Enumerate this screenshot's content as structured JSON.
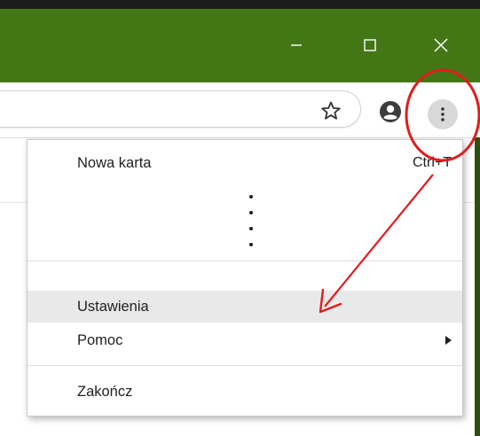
{
  "window_controls": {
    "minimize_icon": "minimize-icon",
    "maximize_icon": "maximize-icon",
    "close_icon": "close-icon"
  },
  "toolbar": {
    "bookmark_icon": "star-icon",
    "account_icon": "account-icon",
    "menu_icon": "vertical-dots-icon"
  },
  "menu": {
    "items": [
      {
        "label": "Nowa karta",
        "shortcut": "Ctrl+T"
      },
      {
        "label": "Ustawienia",
        "highlighted": true
      },
      {
        "label": "Pomoc",
        "has_submenu": true
      },
      {
        "label": "Zakończ"
      }
    ],
    "omitted_items_icon": "vertical-ellipsis-icon"
  },
  "colors": {
    "titlebar": "#437716",
    "highlight_row": "#e9e9e9",
    "annotation": "#e21c1c"
  }
}
